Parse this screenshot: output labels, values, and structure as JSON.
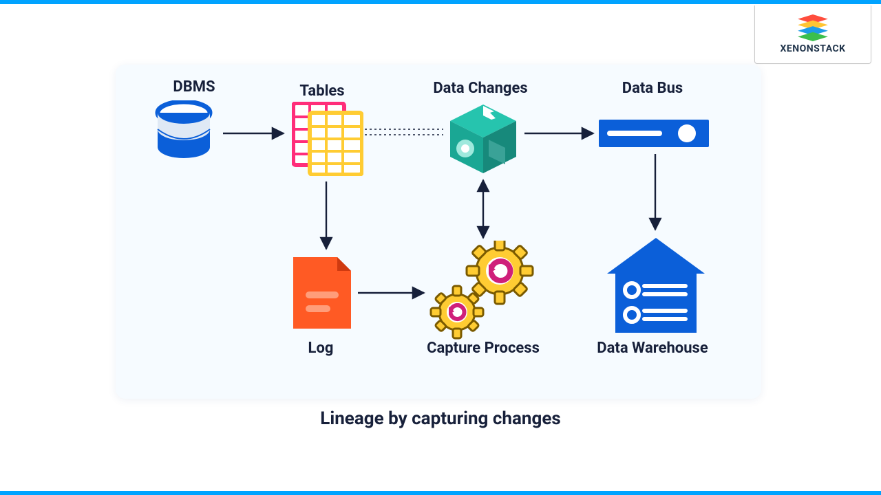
{
  "brand": {
    "name": "XENONSTACK"
  },
  "caption": "Lineage by capturing changes",
  "nodes": {
    "dbms": {
      "label": "DBMS"
    },
    "tables": {
      "label": "Tables"
    },
    "changes": {
      "label": "Data Changes"
    },
    "bus": {
      "label": "Data Bus"
    },
    "log": {
      "label": "Log"
    },
    "capture": {
      "label": "Capture Process"
    },
    "warehouse": {
      "label": "Data Warehouse"
    }
  },
  "edges": [
    {
      "from": "dbms",
      "to": "tables",
      "style": "solid",
      "dir": "one"
    },
    {
      "from": "tables",
      "to": "changes",
      "style": "dotted",
      "dir": "one"
    },
    {
      "from": "changes",
      "to": "bus",
      "style": "solid",
      "dir": "one"
    },
    {
      "from": "tables",
      "to": "log",
      "style": "solid",
      "dir": "one"
    },
    {
      "from": "log",
      "to": "capture",
      "style": "solid",
      "dir": "one"
    },
    {
      "from": "changes",
      "to": "capture",
      "style": "solid",
      "dir": "both"
    },
    {
      "from": "bus",
      "to": "warehouse",
      "style": "solid",
      "dir": "one"
    }
  ],
  "colors": {
    "accent": "#00a3ff",
    "text": "#17203a",
    "dbms_blue": "#0b5fd9",
    "table_pink": "#ff2d7a",
    "table_yellow": "#ffcc33",
    "change_teal": "#1fbfa9",
    "bus_blue": "#0b5fd9",
    "log_orange": "#ff5a24",
    "gear_yellow": "#ffcc33",
    "gear_magenta": "#cf1f7a",
    "warehouse_blue": "#0b5fd9"
  }
}
